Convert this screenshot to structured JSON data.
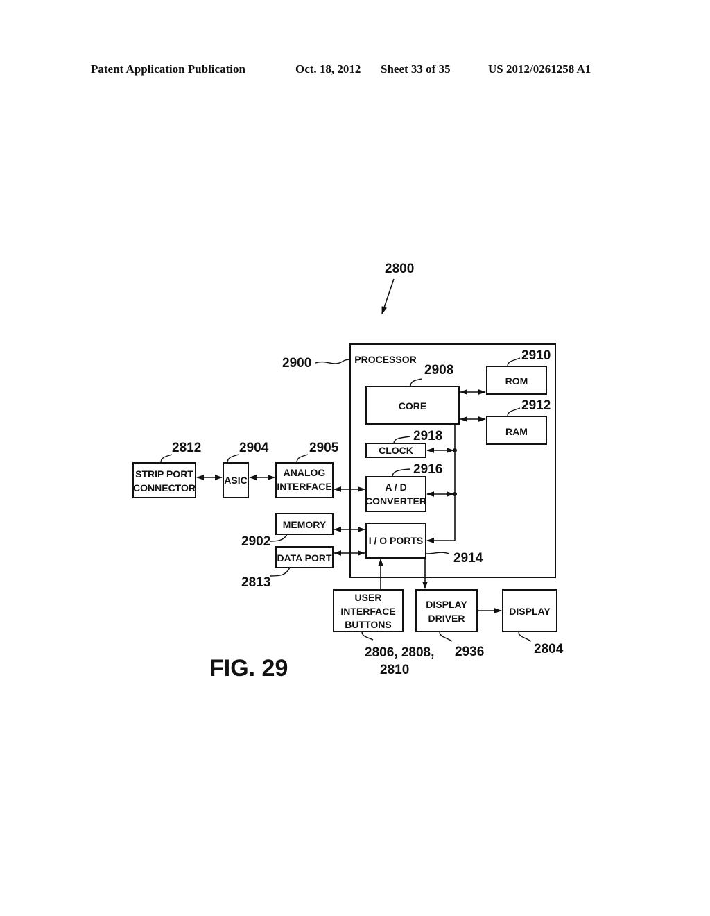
{
  "header": {
    "publication": "Patent Application Publication",
    "date": "Oct. 18, 2012",
    "sheet": "Sheet 33 of 35",
    "number": "US 2012/0261258 A1"
  },
  "figure": {
    "label": "FIG. 29",
    "system_ref": "2800",
    "processor": {
      "label": "PROCESSOR",
      "ref": "2900"
    },
    "blocks": {
      "core": {
        "lines": [
          "CORE"
        ],
        "ref": "2908"
      },
      "rom": {
        "lines": [
          "ROM"
        ],
        "ref": "2910"
      },
      "ram": {
        "lines": [
          "RAM"
        ],
        "ref": "2912"
      },
      "clock": {
        "lines": [
          "CLOCK"
        ],
        "ref": "2918"
      },
      "adc": {
        "lines": [
          "A / D",
          "CONVERTER"
        ],
        "ref": "2916"
      },
      "io": {
        "lines": [
          "I / O PORTS"
        ],
        "ref": "2914"
      },
      "strip": {
        "lines": [
          "STRIP PORT",
          "CONNECTOR"
        ],
        "ref": "2812"
      },
      "asic": {
        "lines": [
          "ASIC"
        ],
        "ref": "2904"
      },
      "analog": {
        "lines": [
          "ANALOG",
          "INTERFACE"
        ],
        "ref": "2905"
      },
      "memory": {
        "lines": [
          "MEMORY"
        ],
        "ref": "2902"
      },
      "dataport": {
        "lines": [
          "DATA PORT"
        ],
        "ref": "2813"
      },
      "uib": {
        "lines": [
          "USER",
          "INTERFACE",
          "BUTTONS"
        ],
        "ref_lines": [
          "2806, 2808,",
          "2810"
        ]
      },
      "driver": {
        "lines": [
          "DISPLAY",
          "DRIVER"
        ],
        "ref": "2936"
      },
      "display": {
        "lines": [
          "DISPLAY"
        ],
        "ref": "2804"
      }
    }
  }
}
